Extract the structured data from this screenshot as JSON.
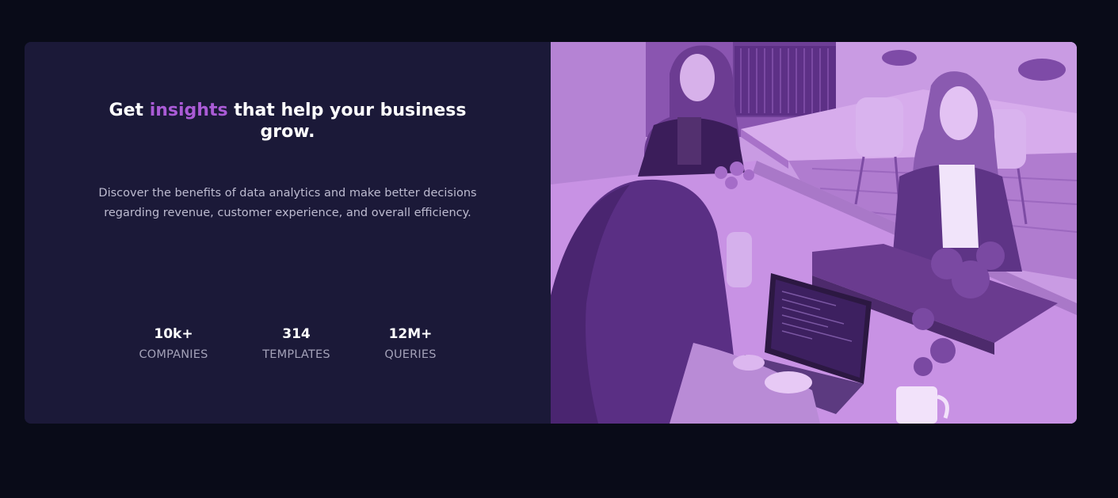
{
  "hero": {
    "headline_pre": "Get",
    "headline_accent": "insights",
    "headline_post": "that help your business grow.",
    "description": "Discover the benefits of data analytics and make better decisions regarding revenue, customer experience, and overall efficiency."
  },
  "stats": [
    {
      "value": "10k+",
      "label": "COMPANIES"
    },
    {
      "value": "314",
      "label": "TEMPLATES"
    },
    {
      "value": "12M+",
      "label": "QUERIES"
    }
  ],
  "colors": {
    "page_background": "#090b18",
    "card_background": "#1b1938",
    "accent": "#aa5bd6",
    "photo_tint": "#c99be3"
  }
}
